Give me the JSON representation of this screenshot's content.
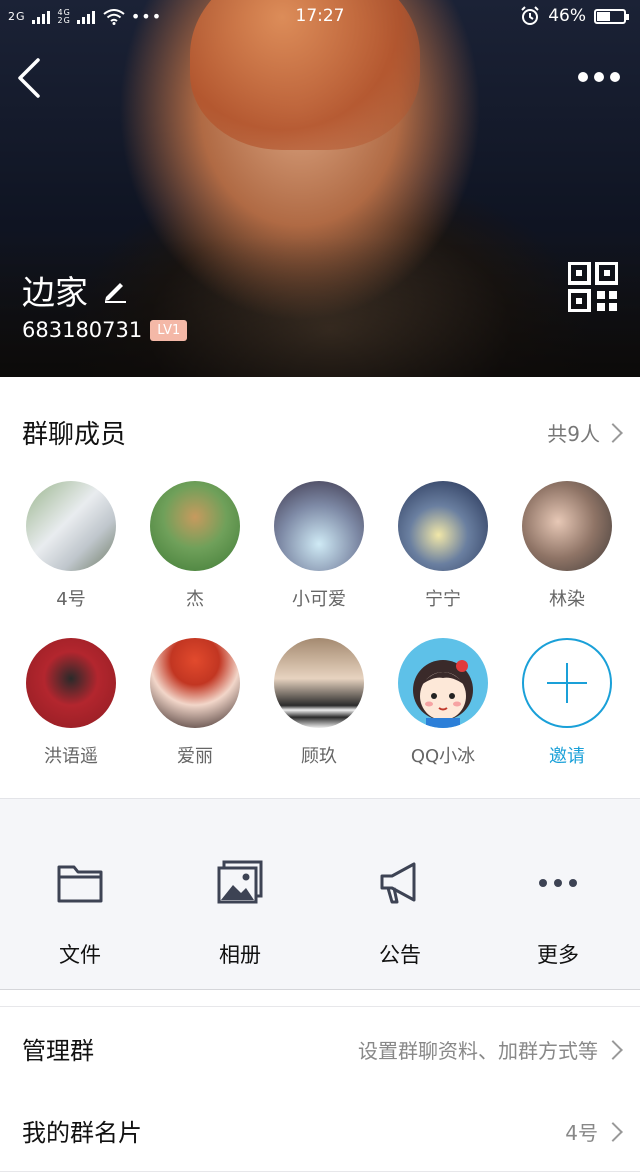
{
  "status_bar": {
    "signal_left": "2G",
    "signal_right_top": "4G",
    "signal_right_bottom": "2G",
    "time": "17:27",
    "battery_text": "46%",
    "battery_level": 0.46
  },
  "header": {
    "group_name": "边家",
    "group_id": "683180731",
    "level_badge": "LV1"
  },
  "members_section": {
    "title": "群聊成员",
    "count_text": "共9人",
    "members": [
      {
        "name": "4号"
      },
      {
        "name": "杰"
      },
      {
        "name": "小可爱"
      },
      {
        "name": "宁宁"
      },
      {
        "name": "林染"
      },
      {
        "name": "洪语遥"
      },
      {
        "name": "爱丽"
      },
      {
        "name": "顾玖"
      },
      {
        "name": "QQ小冰"
      }
    ],
    "invite_label": "邀请"
  },
  "tools": [
    {
      "label": "文件",
      "icon": "folder-icon"
    },
    {
      "label": "相册",
      "icon": "album-icon"
    },
    {
      "label": "公告",
      "icon": "megaphone-icon"
    },
    {
      "label": "更多",
      "icon": "more-dots-icon"
    }
  ],
  "rows": {
    "manage": {
      "title": "管理群",
      "value": "设置群聊资料、加群方式等"
    },
    "card": {
      "title": "我的群名片",
      "value": "4号"
    }
  },
  "colors": {
    "accent": "#1aa0d8",
    "level_badge": "#f4b8a7",
    "tool_bg": "#f5f6f9"
  }
}
